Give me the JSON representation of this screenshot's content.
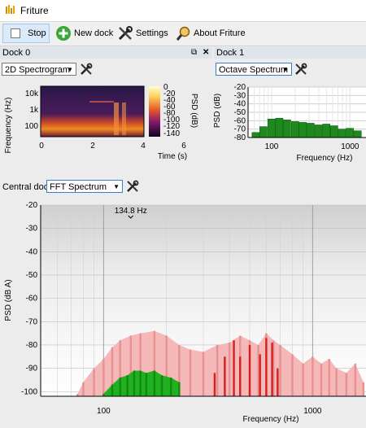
{
  "window": {
    "title": "Friture"
  },
  "toolbar": {
    "stop_label": "Stop",
    "new_dock_label": "New dock",
    "settings_label": "Settings",
    "about_label": "About Friture"
  },
  "dock0": {
    "title": "Dock 0",
    "widget": "2D Spectrogram",
    "ylabel": "Frequency (Hz)",
    "xlabel": "Time (s)",
    "yticks": [
      "10k",
      "1k",
      "100"
    ],
    "xticks": [
      "0",
      "2",
      "4",
      "6"
    ],
    "colorbar_label": "PSD (dB)",
    "colorbar_ticks": [
      "0",
      "-20",
      "-40",
      "-60",
      "-80",
      "-100",
      "-120",
      "-140"
    ]
  },
  "dock1": {
    "title": "Dock 1",
    "widget": "Octave Spectrum",
    "ylabel": "PSD (dB)",
    "xlabel": "Frequency (Hz)",
    "yticks": [
      "-20",
      "-30",
      "-40",
      "-50",
      "-60",
      "-70",
      "-80"
    ],
    "xticks": [
      "100",
      "1000"
    ]
  },
  "central": {
    "label": "Central dock",
    "widget": "FFT Spectrum",
    "ylabel": "PSD (dB A)",
    "xlabel": "Frequency (Hz)",
    "peak_label": "134.8 Hz",
    "yticks": [
      "-20",
      "-30",
      "-40",
      "-50",
      "-60",
      "-70",
      "-80",
      "-90",
      "-100"
    ],
    "xticks": [
      "100",
      "1000"
    ]
  },
  "colors": {
    "octave_bar": "#1e8a1e",
    "fft_light": "#f4b8b8",
    "fft_mid": "#e89090",
    "fft_red": "#d42020",
    "fft_green": "#20b020",
    "selection": "#3a7ad3"
  },
  "chart_data": [
    {
      "type": "bar",
      "name": "octave-spectrum",
      "xscale": "log",
      "xlim": [
        50,
        1600
      ],
      "ylim": [
        -80,
        -20
      ],
      "bands": [
        {
          "f": 63,
          "value": -74
        },
        {
          "f": 79,
          "value": -67
        },
        {
          "f": 100,
          "value": -58
        },
        {
          "f": 126,
          "value": -57
        },
        {
          "f": 158,
          "value": -59
        },
        {
          "f": 200,
          "value": -61
        },
        {
          "f": 251,
          "value": -62
        },
        {
          "f": 316,
          "value": -63
        },
        {
          "f": 398,
          "value": -65
        },
        {
          "f": 501,
          "value": -64
        },
        {
          "f": 631,
          "value": -66
        },
        {
          "f": 794,
          "value": -70
        },
        {
          "f": 1000,
          "value": -69
        },
        {
          "f": 1259,
          "value": -72
        }
      ]
    },
    {
      "type": "area",
      "name": "fft-spectrum",
      "xscale": "log",
      "xlim": [
        50,
        1800
      ],
      "ylim": [
        -102,
        -20
      ],
      "peak_frequency": 134.8,
      "series": [
        {
          "name": "max-hold",
          "points": [
            [
              75,
              -101
            ],
            [
              80,
              -96
            ],
            [
              90,
              -90
            ],
            [
              100,
              -86
            ],
            [
              110,
              -81
            ],
            [
              120,
              -78
            ],
            [
              135,
              -76
            ],
            [
              150,
              -75
            ],
            [
              175,
              -74
            ],
            [
              200,
              -76
            ],
            [
              230,
              -80
            ],
            [
              260,
              -82
            ],
            [
              300,
              -83
            ],
            [
              350,
              -80
            ],
            [
              400,
              -79
            ],
            [
              450,
              -76
            ],
            [
              500,
              -78
            ],
            [
              550,
              -80
            ],
            [
              600,
              -75
            ],
            [
              650,
              -78
            ],
            [
              700,
              -80
            ],
            [
              800,
              -84
            ],
            [
              900,
              -88
            ],
            [
              1000,
              -85
            ],
            [
              1100,
              -88
            ],
            [
              1200,
              -86
            ],
            [
              1300,
              -90
            ],
            [
              1450,
              -92
            ],
            [
              1600,
              -88
            ],
            [
              1750,
              -96
            ]
          ]
        },
        {
          "name": "current",
          "points": [
            [
              100,
              -101
            ],
            [
              110,
              -97
            ],
            [
              120,
              -94
            ],
            [
              130,
              -93
            ],
            [
              140,
              -91
            ],
            [
              150,
              -91
            ],
            [
              160,
              -92
            ],
            [
              175,
              -91
            ],
            [
              190,
              -93
            ],
            [
              210,
              -94
            ],
            [
              230,
              -96
            ]
          ]
        },
        {
          "name": "peaks",
          "points": [
            [
              340,
              -92
            ],
            [
              380,
              -85
            ],
            [
              420,
              -78
            ],
            [
              450,
              -85
            ],
            [
              500,
              -80
            ],
            [
              560,
              -84
            ],
            [
              600,
              -77
            ],
            [
              640,
              -79
            ],
            [
              680,
              -90
            ]
          ]
        }
      ]
    }
  ]
}
